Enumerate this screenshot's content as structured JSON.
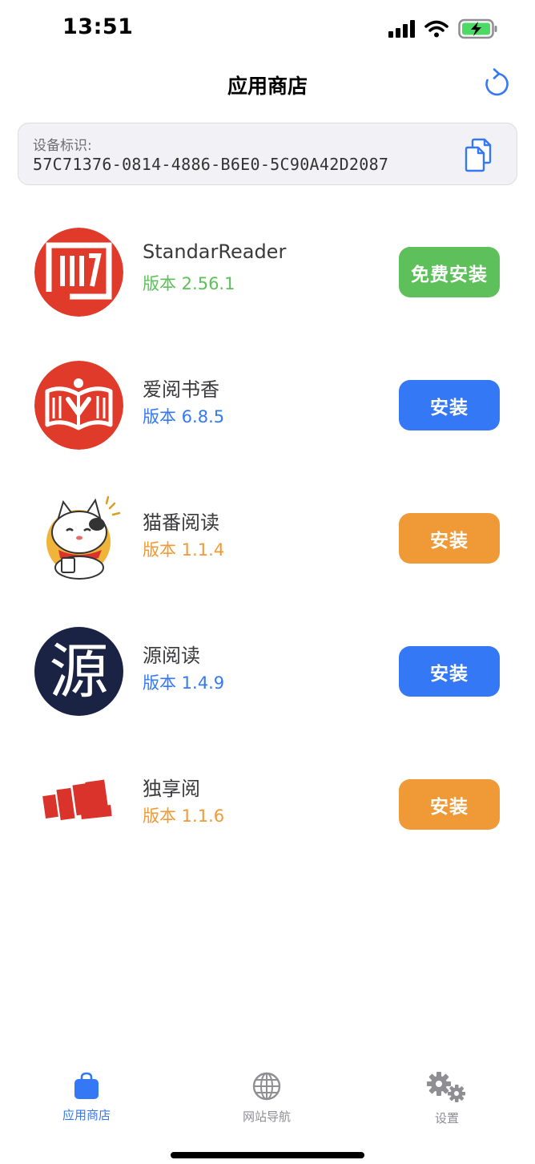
{
  "status_bar": {
    "time": "13:51",
    "icons": [
      "cellular-signal-icon",
      "wifi-icon",
      "battery-charging-icon"
    ]
  },
  "nav": {
    "title": "应用商店",
    "refresh_icon": "refresh-icon"
  },
  "device": {
    "label": "设备标识:",
    "id": "57C71376-0814-4886-B6E0-5C90A42D2087",
    "copy_icon": "copy-icon"
  },
  "apps": [
    {
      "name": "StandarReader",
      "version": "版本 2.56.1",
      "button": "免费安装",
      "accent": "#5dc05a",
      "icon": "standar-reader-logo"
    },
    {
      "name": "爱阅书香",
      "version": "版本 6.8.5",
      "button": "安装",
      "accent": "#3478f6",
      "icon": "ai-yue-shu-xiang-logo"
    },
    {
      "name": "猫番阅读",
      "version": "版本 1.1.4",
      "button": "安装",
      "accent": "#f09a37",
      "icon": "mao-fan-cat-logo"
    },
    {
      "name": "源阅读",
      "version": "版本 1.4.9",
      "button": "安装",
      "accent": "#3478f6",
      "icon": "yuan-yue-du-logo"
    },
    {
      "name": "独享阅",
      "version": "版本 1.1.6",
      "button": "安装",
      "accent": "#f09a37",
      "icon": "du-xiang-yue-logo"
    }
  ],
  "logo_text": {
    "yuan": "源"
  },
  "tab_bar": {
    "tabs": [
      {
        "label": "应用商店",
        "icon": "shopping-bag-icon",
        "active": true
      },
      {
        "label": "网站导航",
        "icon": "globe-icon",
        "active": false
      },
      {
        "label": "设置",
        "icon": "gears-icon",
        "active": false
      }
    ],
    "active_color": "#3478f6",
    "inactive_color": "#8e8e93"
  }
}
